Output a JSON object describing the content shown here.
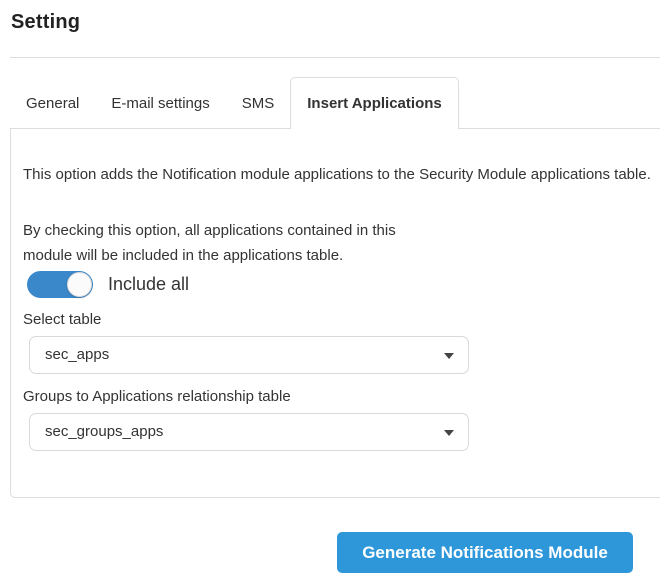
{
  "title": "Setting",
  "tabs": [
    {
      "label": "General",
      "active": false
    },
    {
      "label": "E-mail settings",
      "active": false
    },
    {
      "label": "SMS",
      "active": false
    },
    {
      "label": "Insert Applications",
      "active": true
    }
  ],
  "panel": {
    "description": "This option adds the Notification module applications to the Security Module applications table.",
    "note": "By checking this option, all applications contained in this module will be included in the applications table.",
    "toggle_label": "Include all",
    "toggle_state": "on",
    "select_table_label": "Select table",
    "select_table_value": "sec_apps",
    "relationship_label": "Groups to Applications relationship table",
    "relationship_value": "sec_groups_apps"
  },
  "actions": {
    "generate_button": "Generate Notifications Module"
  },
  "colors": {
    "button_blue": "#2d97da",
    "toggle_blue": "#3a87c9",
    "border_gray": "#dddddd",
    "text_dark": "#333333"
  }
}
